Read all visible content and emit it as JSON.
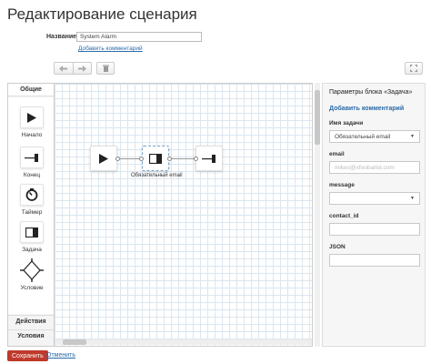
{
  "page": {
    "title": "Редактирование сценария"
  },
  "scenario": {
    "name_label": "Название",
    "name_value": "System Alarm",
    "add_comment": "Добавить комментарий"
  },
  "toolbar": {
    "undo_icon": "undo-icon",
    "redo_icon": "redo-icon",
    "delete_icon": "trash-icon",
    "fit_icon": "expand-icon"
  },
  "palette": {
    "tabs": [
      "Общие",
      "Действия",
      "Условия"
    ],
    "items": [
      {
        "label": "Начало",
        "icon": "play-icon"
      },
      {
        "label": "Конец",
        "icon": "end-icon"
      },
      {
        "label": "Таймер",
        "icon": "timer-icon"
      },
      {
        "label": "Задача",
        "icon": "task-icon"
      },
      {
        "label": "Условие",
        "icon": "condition-icon"
      }
    ]
  },
  "canvas": {
    "nodes": [
      {
        "type": "start",
        "label": ""
      },
      {
        "type": "task",
        "label": "Обязательный email"
      },
      {
        "type": "end",
        "label": ""
      }
    ]
  },
  "properties": {
    "title": "Параметры блока «Задача»",
    "add_comment": "Добавить комментарий",
    "fields": [
      {
        "label": "Имя задачи",
        "kind": "select",
        "value": "Обязательный email"
      },
      {
        "label": "email",
        "kind": "input",
        "value": "mikes@xfoobarlol.com"
      },
      {
        "label": "message",
        "kind": "select",
        "value": ""
      },
      {
        "label": "contact_id",
        "kind": "input",
        "value": ""
      },
      {
        "label": "JSON",
        "kind": "input",
        "value": ""
      }
    ]
  },
  "footer": {
    "save": "Сохранить",
    "cancel": "Отменить"
  },
  "colors": {
    "accent_red": "#c0392b",
    "link": "#2a6aa8",
    "grid": "#dbe6ef"
  }
}
